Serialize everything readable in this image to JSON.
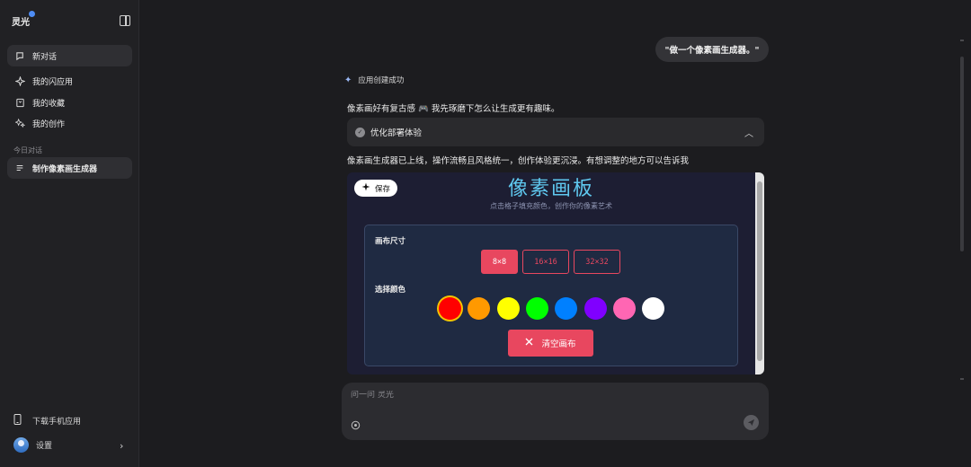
{
  "sidebar": {
    "logo": "灵光",
    "items": [
      {
        "label": "新对话",
        "icon": "new-chat-icon"
      },
      {
        "label": "我的闪应用",
        "icon": "sparkle-app-icon"
      },
      {
        "label": "我的收藏",
        "icon": "bookmark-icon"
      },
      {
        "label": "我的创作",
        "icon": "create-icon"
      }
    ],
    "section_label": "今日对话",
    "history": [
      {
        "label": "制作像素画生成器"
      }
    ],
    "download": "下载手机应用",
    "settings": "设置"
  },
  "chat": {
    "user_message": "\"做一个像素画生成器。\"",
    "status": "应用创建成功",
    "message_1": "像素画好有复古感 🎮 我先琢磨下怎么让生成更有趣味。",
    "collapsible_title": "优化部署体验",
    "message_2": "像素画生成器已上线，操作流畅且风格统一，创作体验更沉浸。有想调整的地方可以告诉我"
  },
  "preview": {
    "save_label": "保存",
    "title": "像素画板",
    "subtitle": "点击格子填充颜色，创作你的像素艺术",
    "size_label": "画布尺寸",
    "sizes": [
      "8×8",
      "16×16",
      "32×32"
    ],
    "selected_size": "8×8",
    "color_label": "选择颜色",
    "colors": [
      "#ff0000",
      "#ff9900",
      "#ffff00",
      "#00ff00",
      "#0080ff",
      "#8000ff",
      "#ff66b3",
      "#ffffff"
    ],
    "selected_color": "#ff0000",
    "clear_label": "清空画布"
  },
  "input": {
    "placeholder": "问一问 灵光"
  }
}
